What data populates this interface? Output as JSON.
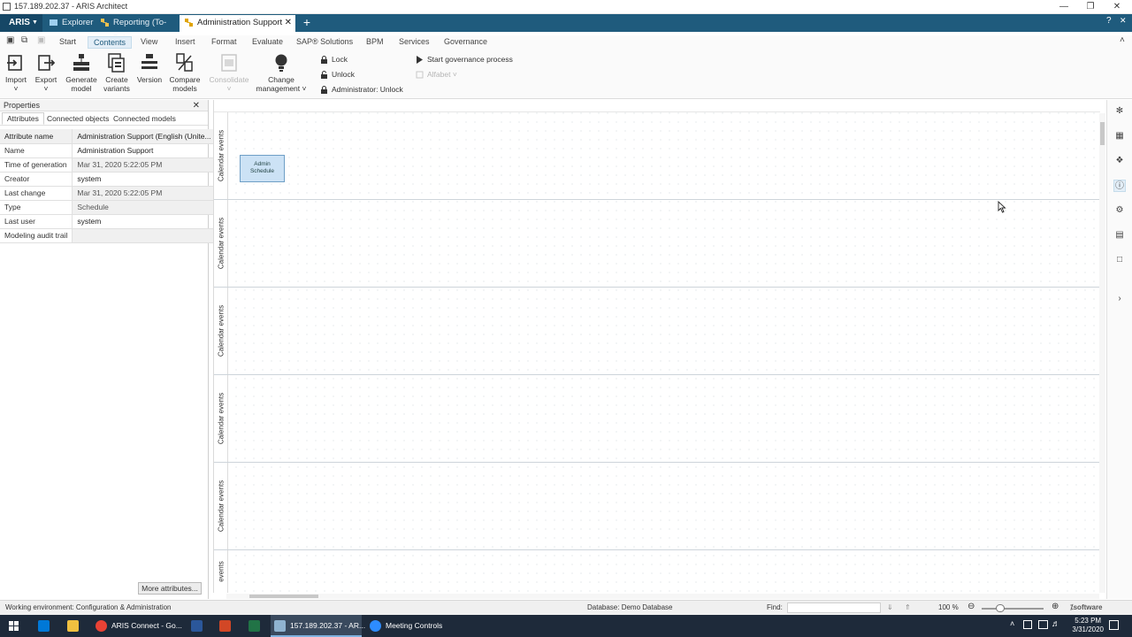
{
  "window": {
    "title": "157.189.202.37 - ARIS Architect"
  },
  "tabbar": {
    "logo": "ARIS",
    "tabs": [
      {
        "label": "Explorer"
      },
      {
        "label": "Reporting (To-Be)"
      },
      {
        "label": "Administration Support"
      }
    ],
    "help": "?"
  },
  "menubar": {
    "items": [
      "Start",
      "Contents",
      "View",
      "Insert",
      "Format",
      "Evaluate",
      "SAP® Solutions",
      "BPM",
      "Services",
      "Governance"
    ],
    "active": "Contents"
  },
  "ribbon": {
    "buttons": [
      {
        "line1": "Import",
        "line2": "˅"
      },
      {
        "line1": "Export",
        "line2": "˅"
      },
      {
        "line1": "Generate",
        "line2": "model"
      },
      {
        "line1": "Create",
        "line2": "variants"
      },
      {
        "line1": "Version",
        "line2": ""
      },
      {
        "line1": "Compare",
        "line2": "models"
      },
      {
        "line1": "Consolidate",
        "line2": "˅"
      },
      {
        "line1": "Change",
        "line2": "management ˅"
      }
    ],
    "small": [
      {
        "label": "Lock"
      },
      {
        "label": "Unlock"
      },
      {
        "label": "Administrator: Unlock"
      },
      {
        "label": "Start governance process"
      },
      {
        "label": "Alfabet ˅"
      }
    ]
  },
  "properties": {
    "title": "Properties",
    "tabs": [
      "Attributes",
      "Connected objects",
      "Connected models"
    ],
    "header": {
      "name": "Attribute name",
      "value": "Administration Support (English (Unite..."
    },
    "rows": [
      {
        "name": "Name",
        "value": "Administration Support"
      },
      {
        "name": "Time of generation",
        "value": "Mar 31, 2020 5:22:05 PM"
      },
      {
        "name": "Creator",
        "value": "system"
      },
      {
        "name": "Last change",
        "value": "Mar 31, 2020 5:22:05 PM"
      },
      {
        "name": "Type",
        "value": "Schedule"
      },
      {
        "name": "Last user",
        "value": "system"
      },
      {
        "name": "Modeling audit trail",
        "value": ""
      }
    ],
    "more_button": "More attributes..."
  },
  "canvas": {
    "lanes": [
      "Calendar events",
      "Calendar events",
      "Calendar events",
      "Calendar events",
      "Calendar events",
      "events"
    ],
    "object": {
      "line1": "Admin",
      "line2": "Schedule"
    }
  },
  "status": {
    "environment": "Working environment: Configuration & Administration",
    "database": "Database: Demo Database",
    "find_label": "Find:",
    "zoom": "100 %",
    "brand": "software"
  },
  "taskbar": {
    "items": [
      {
        "label": "ARIS Connect - Go..."
      },
      {
        "label": "157.189.202.37 - AR..."
      },
      {
        "label": "Meeting Controls"
      }
    ],
    "time": "5:23 PM",
    "date": "3/31/2020"
  },
  "colors": {
    "tabbar": "#1f5b7d",
    "object_fill": "#cce2f5",
    "taskbar": "#1e2a3a"
  }
}
